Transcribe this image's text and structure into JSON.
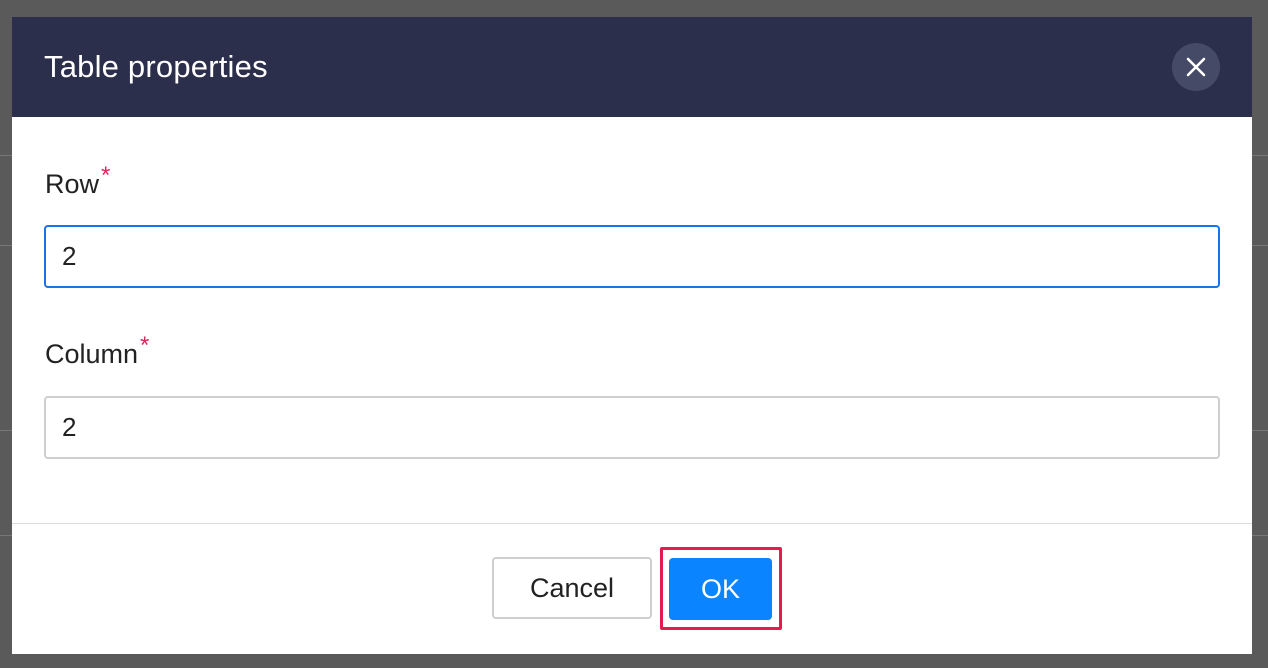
{
  "dialog": {
    "title": "Table properties",
    "close_icon": "close-icon"
  },
  "fields": {
    "row": {
      "label": "Row",
      "required_mark": "*",
      "value": "2"
    },
    "column": {
      "label": "Column",
      "required_mark": "*",
      "value": "2"
    }
  },
  "footer": {
    "cancel_label": "Cancel",
    "ok_label": "OK"
  },
  "colors": {
    "header_bg": "#2b2f4c",
    "primary": "#0a84ff",
    "required": "#e0245e",
    "highlight": "#e8194f",
    "focus_border": "#1a73e8"
  }
}
